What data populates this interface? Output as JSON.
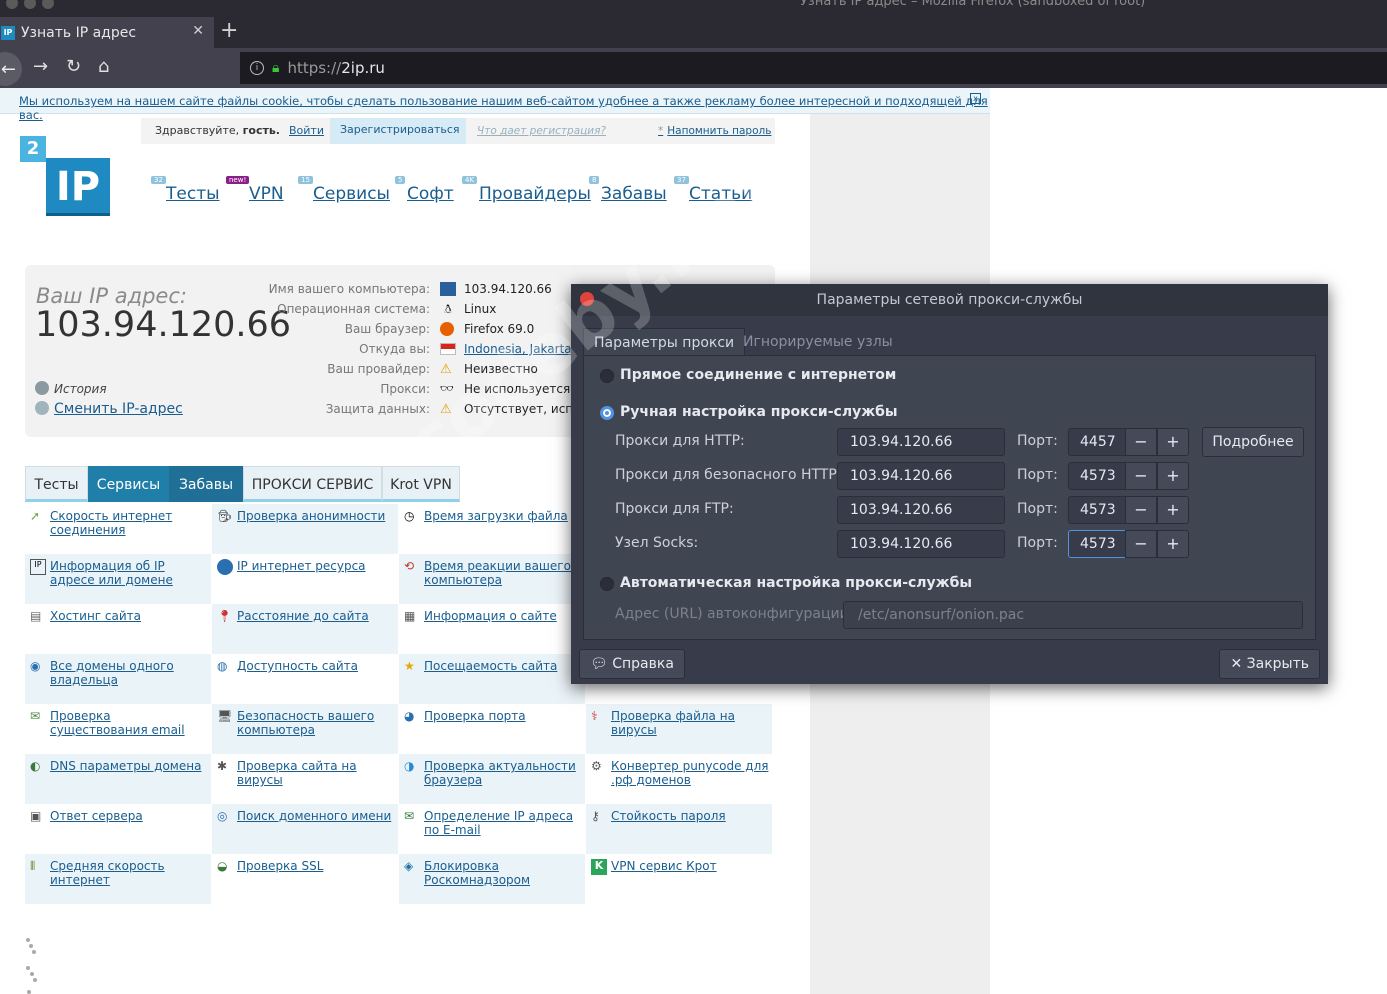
{
  "window": {
    "title": "Узнать IP адрес – Mozilla Firefox (sandboxed of root)"
  },
  "browser": {
    "tab_title": "Узнать IP адрес",
    "favicon_text": "IP",
    "url_protocol": "https://",
    "url_host": "2ip.ru",
    "icons": {
      "back": "back-arrow-icon",
      "forward": "forward-arrow-icon",
      "reload": "reload-icon",
      "home": "home-icon",
      "lock": "lock-icon"
    }
  },
  "cookie_notice": {
    "text": "Мы используем на нашем сайте файлы cookie, чтобы сделать пользование нашим веб-сайтом удобнее а также рекламу более интересной и подходящей для вас.",
    "close": "x"
  },
  "account": {
    "greeting_prefix": "Здравствуйте,",
    "greeting_name": "гость.",
    "login": "Войти",
    "register": "Зарегистрироваться",
    "what_gives": "Что дает регистрация?",
    "remind_star": "*",
    "remind_password": "Напомнить пароль"
  },
  "logo": {
    "two": "2",
    "ip": "IP"
  },
  "nav": [
    {
      "label": "Тесты",
      "badge": "32"
    },
    {
      "label": "VPN",
      "badge": "new!"
    },
    {
      "label": "Сервисы",
      "badge": "15"
    },
    {
      "label": "Софт",
      "badge": "5"
    },
    {
      "label": "Провайдеры",
      "badge": "4K"
    },
    {
      "label": "Забавы",
      "badge": "8"
    },
    {
      "label": "Статьи",
      "badge": "37"
    }
  ],
  "ip_panel": {
    "your_ip_label": "Ваш IP адрес:",
    "ip": "103.94.120.66",
    "history": "История",
    "change_ip": "Сменить IP-адрес",
    "rows": [
      {
        "key": "Имя вашего компьютера:",
        "value": "103.94.120.66",
        "icon": "computer-icon"
      },
      {
        "key": "Операционная система:",
        "value": "Linux",
        "icon": "linux-penguin-icon"
      },
      {
        "key": "Ваш браузер:",
        "value": "Firefox 69.0",
        "icon": "firefox-icon"
      },
      {
        "key": "Откуда вы:",
        "value": "Indonesia, Jakarta",
        "icon": "indonesia-flag-icon"
      },
      {
        "key": "Ваш провайдер:",
        "value": "Неизвестно",
        "icon": "warning-icon"
      },
      {
        "key": "Прокси:",
        "value": "Не используется, у",
        "icon": "spy-glasses-icon"
      },
      {
        "key": "Защита данных:",
        "value": "Отсутствует, испра",
        "icon": "warning-icon"
      }
    ]
  },
  "service_tabs": [
    "Тесты",
    "Сервисы",
    "Забавы",
    "ПРОКСИ СЕРВИС",
    "Krot VPN"
  ],
  "services": [
    [
      "Скорость интернет соединения",
      "Проверка анонимности",
      "Время загрузки файла",
      ""
    ],
    [
      "Информация об IP адресе или домене",
      "IP интернет ресурса",
      "Время реакции вашего компьютера",
      ""
    ],
    [
      "Хостинг сайта",
      "Расстояние до сайта",
      "Информация о сайте",
      ""
    ],
    [
      "Все домены одного владельца",
      "Доступность сайта",
      "Посещаемость сайта",
      ""
    ],
    [
      "Проверка существования email",
      "Безопасность вашего компьютера",
      "Проверка порта",
      "Проверка файла на вирусы"
    ],
    [
      "DNS параметры домена",
      "Проверка сайта на вирусы",
      "Проверка актуальности браузера",
      "Конвертер punycode для .рф доменов"
    ],
    [
      "Ответ сервера",
      "Поиск доменного имени",
      "Определение IP адреса по E-mail",
      "Стойкость пароля"
    ],
    [
      "Средняя скорость интернет",
      "Проверка SSL",
      "Блокировка Роскомнадзором",
      "VPN сервис Крот"
    ]
  ],
  "dialog": {
    "title": "Параметры сетевой прокси-службы",
    "tabs": [
      "Параметры прокси",
      "Игнорируемые узлы"
    ],
    "direct": "Прямое соединение с интернетом",
    "manual": "Ручная настройка прокси-службы",
    "port_label": "Порт:",
    "proxies": [
      {
        "label": "Прокси для HTTP:",
        "host": "103.94.120.66",
        "port": "4457"
      },
      {
        "label": "Прокси для безопасного HTTP:",
        "host": "103.94.120.66",
        "port": "4573"
      },
      {
        "label": "Прокси для FTP:",
        "host": "103.94.120.66",
        "port": "4573"
      },
      {
        "label": "Узел Socks:",
        "host": "103.94.120.66",
        "port": "4573"
      }
    ],
    "more": "Подробнее",
    "auto": "Автоматическая настройка прокси-службы",
    "auto_url_label": "Адрес (URL) автоконфигурации:",
    "auto_url": "/etc/anonsurf/onion.pac",
    "help": "Справка",
    "close": "Закрыть",
    "selected_mode": "manual"
  },
  "watermark": "codeby.net"
}
